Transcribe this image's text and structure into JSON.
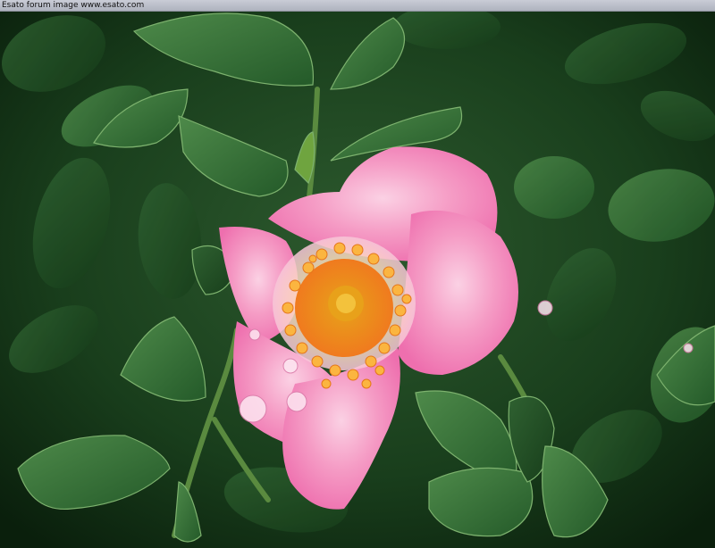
{
  "watermark": {
    "text": "Esato forum image www.esato.com"
  },
  "scene": {
    "subject": "flower",
    "colors": {
      "petal": "#f07fb6",
      "petal_light": "#f9c3dd",
      "stamen": "#f39a2a",
      "foliage_dark": "#0d2b10",
      "foliage": "#2f6b33",
      "foliage_light": "#5f9a57"
    }
  }
}
